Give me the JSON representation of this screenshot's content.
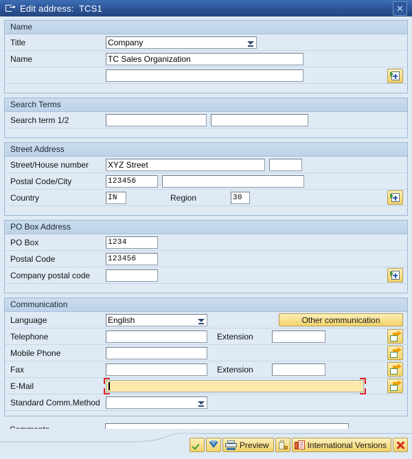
{
  "window": {
    "title": "Edit address:  TCS1",
    "title_icon": "edit-address-icon",
    "close_label": "✕"
  },
  "sections": {
    "name": {
      "header": "Name",
      "title_label": "Title",
      "title_value": "Company",
      "name_label": "Name",
      "name_value": "TC Sales Organization",
      "name2_value": "",
      "detail_icon": "address-detail-icon"
    },
    "search_terms": {
      "header": "Search Terms",
      "search_label": "Search term 1/2",
      "search1_value": "",
      "search2_value": ""
    },
    "street_address": {
      "header": "Street Address",
      "street_label": "Street/House number",
      "street_value": "XYZ Street",
      "house_value": "",
      "postal_city_label": "Postal Code/City",
      "postal_value": "123456",
      "city_value": "",
      "country_label": "Country",
      "country_value": "IN",
      "region_label": "Region",
      "region_value": "30",
      "detail_icon": "address-detail-icon"
    },
    "po_box": {
      "header": "PO Box Address",
      "pobox_label": "PO Box",
      "pobox_value": "1234",
      "postal_label": "Postal Code",
      "postal_value": "123456",
      "company_postal_label": "Company postal code",
      "company_postal_value": "",
      "detail_icon": "address-detail-icon"
    },
    "communication": {
      "header": "Communication",
      "language_label": "Language",
      "language_value": "English",
      "other_comm_button": "Other communication",
      "telephone_label": "Telephone",
      "telephone_value": "",
      "extension_label": "Extension",
      "telephone_ext_value": "",
      "mobile_label": "Mobile Phone",
      "mobile_value": "",
      "fax_label": "Fax",
      "fax_value": "",
      "fax_ext_label": "Extension",
      "fax_ext_value": "",
      "email_label": "E-Mail",
      "email_value": "",
      "std_comm_label": "Standard Comm.Method",
      "std_comm_value": "",
      "goto_icon": "goto-icon"
    }
  },
  "comments": {
    "label": "Comments",
    "value": ""
  },
  "toolbar": {
    "continue_label": "",
    "continue_icon": "green-check-icon",
    "more_icon": "chevron-down-icon",
    "preview_label": "Preview",
    "preview_icon": "printer-icon",
    "lock_icon": "lock-icon",
    "intl_versions_label": "International Versions",
    "intl_versions_icon": "international-versions-icon",
    "cancel_icon": "red-x-icon"
  },
  "colors": {
    "accent": "#2e589b",
    "button": "#f7e08e",
    "focus_field": "#fbe8ab",
    "focus_bracket": "#e02020",
    "panel": "#dfeaf5"
  }
}
